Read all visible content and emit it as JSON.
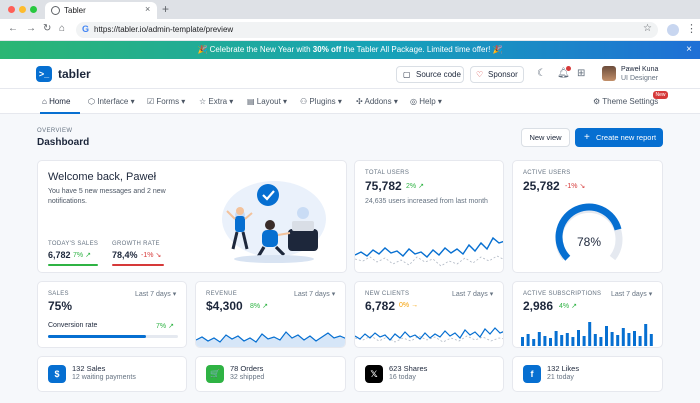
{
  "browser": {
    "tab_title": "Tabler",
    "tab_close": "×",
    "new_tab": "+",
    "url": "https://tabler.io/admin-template/preview",
    "google_glyph": "G"
  },
  "banner": {
    "prefix": "🎉 Celebrate the New Year with ",
    "highlight": "30% off",
    "suffix": " the Tabler All Package. Limited time offer! 🎉",
    "close": "×"
  },
  "header": {
    "brand": "tabler",
    "source_code": "Source code",
    "sponsor": "Sponsor",
    "user_name": "Paweł Kuna",
    "user_role": "UI Designer"
  },
  "nav": {
    "items": [
      "Home",
      "Interface",
      "Forms",
      "Extra",
      "Layout",
      "Plugins",
      "Addons",
      "Help",
      "Theme Settings"
    ],
    "badge": "New"
  },
  "page": {
    "pretitle": "OVERVIEW",
    "title": "Dashboard",
    "new_view": "New view",
    "create_report": "Create new report"
  },
  "welcome": {
    "title": "Welcome back, Paweł",
    "text": "You have 5 new messages and 2 new notifications.",
    "sales_label": "TODAY'S SALES",
    "sales_value": "6,782",
    "sales_change": "7%",
    "growth_label": "GROWTH RATE",
    "growth_value": "78,4%",
    "growth_change": "-1%"
  },
  "total_users": {
    "label": "TOTAL USERS",
    "value": "75,782",
    "change": "2%",
    "note": "24,635 users increased from last month"
  },
  "active_users": {
    "label": "ACTIVE USERS",
    "value": "25,782",
    "change": "-1%",
    "gauge_percent": 78,
    "gauge_label": "78%"
  },
  "sales": {
    "label": "SALES",
    "period": "Last 7 days",
    "value": "75%",
    "progress_label": "Conversion rate",
    "progress_value": "7%",
    "progress_fraction": 0.75
  },
  "revenue": {
    "label": "REVENUE",
    "period": "Last 7 days",
    "value": "$4,300",
    "change": "8%"
  },
  "new_clients": {
    "label": "NEW CLIENTS",
    "period": "Last 7 days",
    "value": "6,782",
    "change": "0%"
  },
  "active_subscriptions": {
    "label": "ACTIVE SUBSCRIPTIONS",
    "period": "Last 7 days",
    "value": "2,986",
    "change": "4%"
  },
  "info_cards": [
    {
      "line1": "132 Sales",
      "line2": "12 waiting payments",
      "icon": "dollar-icon",
      "glyph": "$",
      "color": "#066fd1"
    },
    {
      "line1": "78 Orders",
      "line2": "32 shipped",
      "icon": "cart-icon",
      "glyph": "🛒",
      "color": "#2fb344"
    },
    {
      "line1": "623 Shares",
      "line2": "16 today",
      "icon": "x-logo-icon",
      "glyph": "𝕏",
      "color": "#000000"
    },
    {
      "line1": "132 Likes",
      "line2": "21 today",
      "icon": "facebook-icon",
      "glyph": "f",
      "color": "#066fd1"
    }
  ],
  "colors": {
    "primary": "#066fd1",
    "green": "#2fb344",
    "red": "#d63939",
    "yellow": "#f59f00"
  }
}
